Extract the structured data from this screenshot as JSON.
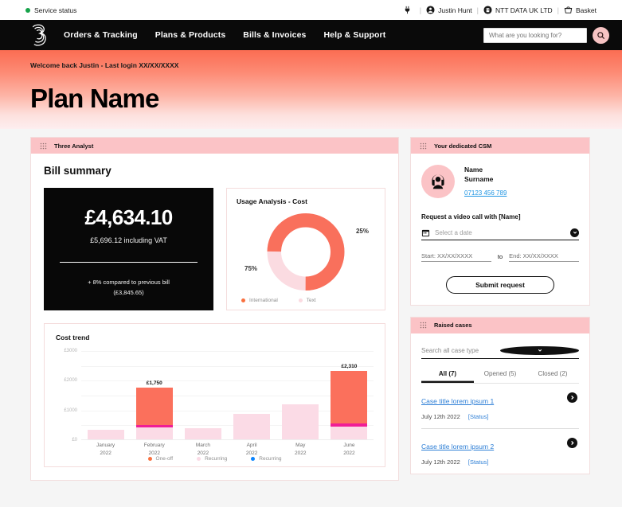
{
  "utility": {
    "service_status": "Service status",
    "status_color": "#16a34a",
    "items": [
      {
        "icon": "plug-icon",
        "label": ""
      },
      {
        "icon": "user-icon",
        "label": "Justin Hunt"
      },
      {
        "icon": "building-icon",
        "label": "NTT DATA UK LTD"
      },
      {
        "icon": "basket-icon",
        "label": "Basket"
      }
    ],
    "separator": "|"
  },
  "nav": {
    "logo": "three-logo",
    "links": [
      "Orders & Tracking",
      "Plans & Products",
      "Bills & Invoices",
      "Help & Support"
    ],
    "search_placeholder": "What are you looking for?",
    "search_value": "",
    "search_button_icon": "search-icon"
  },
  "hero": {
    "welcome": "Welcome back Justin - Last login XX/XX/XXXX",
    "title": "Plan Name",
    "gradient_from": "#fb6d53",
    "gradient_to": "#fdeeef"
  },
  "analyst_card": {
    "header": "Three Analyst",
    "section_title": "Bill summary",
    "bill": {
      "amount": "£4,634.10",
      "vat_line": "£5,696.12 including VAT",
      "comparison": "+ 8% compared to previous bill",
      "previous": "(£3,845.65)"
    }
  },
  "csm_card": {
    "header": "Your dedicated CSM",
    "name_line1": "Name",
    "name_line2": "Surname",
    "phone": "07123 456 789",
    "request_label": "Request a video call with [Name]",
    "date_placeholder": "Select a date",
    "start_label": "Start: XX/XX/XXXX",
    "to_label": "to",
    "end_label": "End: XX/XX/XXXX",
    "submit_label": "Submit request"
  },
  "cases_card": {
    "header": "Raised cases",
    "search_placeholder": "Search all case type",
    "tabs": [
      {
        "label": "All (7)",
        "active": true
      },
      {
        "label": "Opened (5)",
        "active": false
      },
      {
        "label": "Closed (2)",
        "active": false
      }
    ],
    "items": [
      {
        "title": "Case title lorem ipsum 1",
        "date": "July 12th 2022",
        "status": "[Status]"
      },
      {
        "title": "Case title lorem ipsum 2",
        "date": "July 12th 2022",
        "status": "[Status]"
      }
    ]
  },
  "chart_data": [
    {
      "type": "pie",
      "title": "Usage Analysis - Cost",
      "categories": [
        "International",
        "Text"
      ],
      "values": [
        75,
        25
      ],
      "labels": [
        "75%",
        "25%"
      ],
      "colors": [
        "#f9705c",
        "#fbdbe1"
      ],
      "legend_position": "bottom"
    },
    {
      "type": "bar",
      "title": "Cost trend",
      "stacked": true,
      "categories": [
        "January\n2022",
        "February\n2022",
        "March\n2022",
        "April\n2022",
        "May\n2022",
        "June\n2022"
      ],
      "category_lines": [
        [
          "January",
          "2022"
        ],
        [
          "February",
          "2022"
        ],
        [
          "March",
          "2022"
        ],
        [
          "April",
          "2022"
        ],
        [
          "May",
          "2022"
        ],
        [
          "June",
          "2022"
        ]
      ],
      "series": [
        {
          "name": "Recurring",
          "color": "#fbdbe6",
          "values": [
            330,
            400,
            370,
            850,
            1190,
            440
          ]
        },
        {
          "name": "Recurring",
          "color": "#f01e96",
          "values": [
            0,
            90,
            0,
            0,
            0,
            100
          ]
        },
        {
          "name": "One-off",
          "color": "#fb705c",
          "values": [
            0,
            1260,
            0,
            0,
            0,
            1770
          ]
        }
      ],
      "bar_labels": [
        "",
        "£1,750",
        "",
        "",
        "",
        "£2,310"
      ],
      "ylabel": "",
      "xlabel": "",
      "ylim": [
        0,
        3000
      ],
      "yticks": [
        "£0",
        "£1000",
        "£2000",
        "£3000"
      ],
      "ytick_values": [
        0,
        1000,
        2000,
        3000
      ],
      "grid": true,
      "legend": [
        {
          "label": "One-off",
          "color": "#f9703f"
        },
        {
          "label": "Recurring",
          "color": "#fbdbe6"
        },
        {
          "label": "Recurring",
          "color": "#0a84ff"
        }
      ],
      "legend_position": "bottom"
    }
  ]
}
